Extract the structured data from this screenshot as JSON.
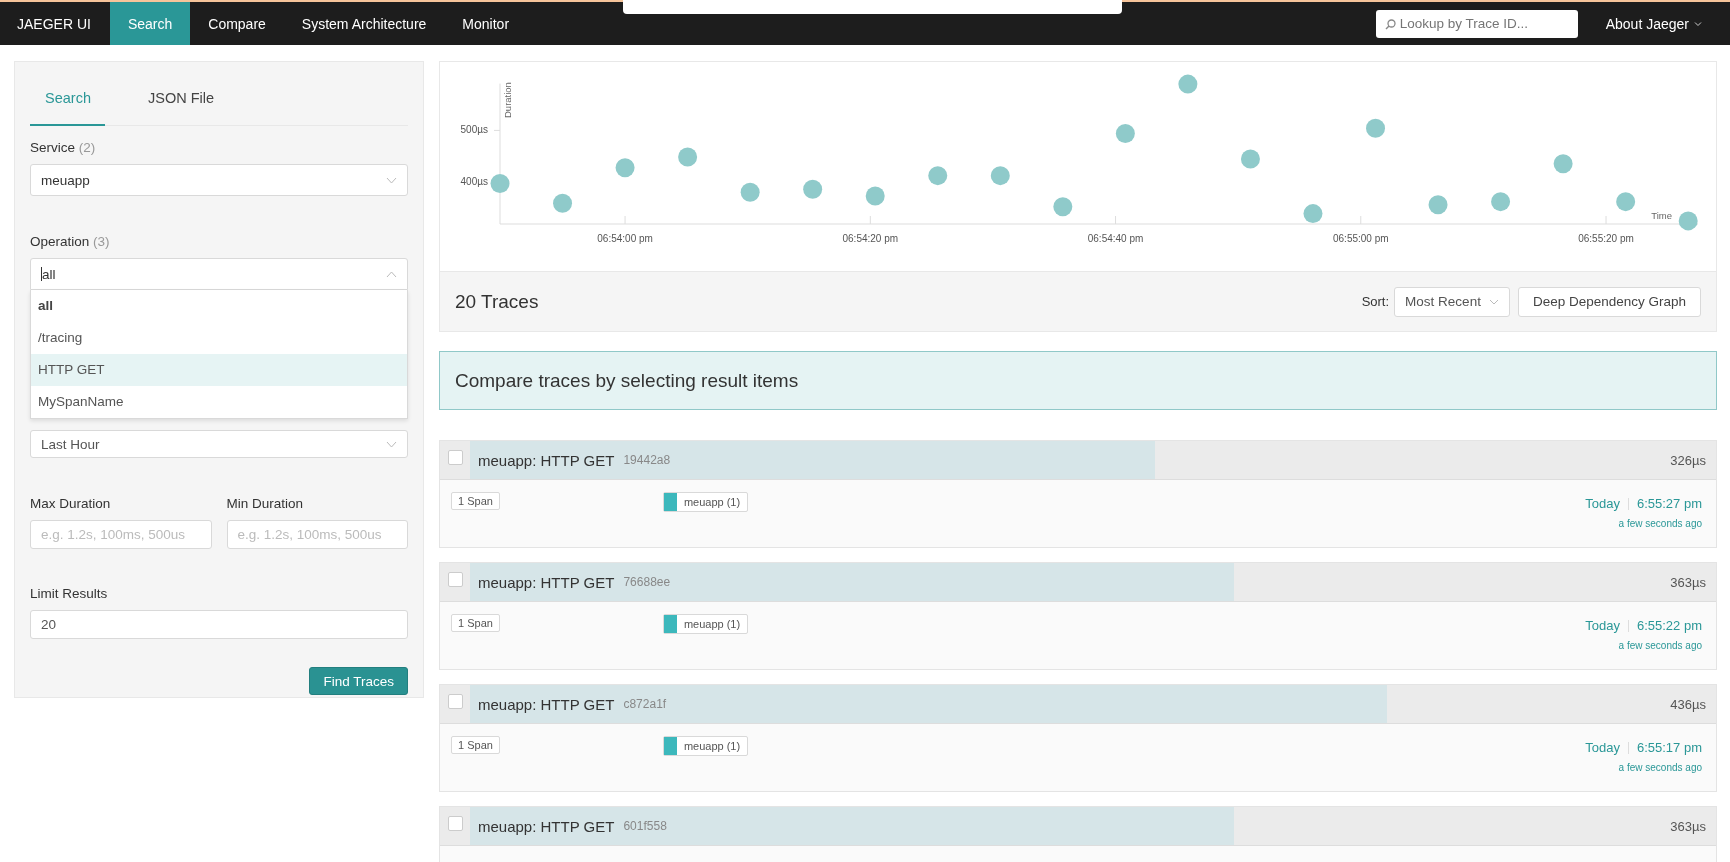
{
  "nav": {
    "brand": "JAEGER UI",
    "tabs": [
      {
        "label": "Search",
        "selected": true
      },
      {
        "label": "Compare",
        "selected": false
      },
      {
        "label": "System Architecture",
        "selected": false
      },
      {
        "label": "Monitor",
        "selected": false
      }
    ],
    "lookup": {
      "placeholder": "Lookup by Trace ID..."
    },
    "about": "About Jaeger"
  },
  "search_panel": {
    "tabs": [
      {
        "label": "Search",
        "selected": true
      },
      {
        "label": "JSON File",
        "selected": false
      }
    ],
    "service": {
      "label": "Service",
      "count": "(2)",
      "value": "meuapp"
    },
    "operation": {
      "label": "Operation",
      "count": "(3)",
      "value": "all",
      "expanded": true,
      "options": [
        {
          "label": "all",
          "selected": true,
          "highlighted": false
        },
        {
          "label": "/tracing",
          "selected": false,
          "highlighted": false
        },
        {
          "label": "HTTP GET",
          "selected": false,
          "highlighted": true
        },
        {
          "label": "MySpanName",
          "selected": false,
          "highlighted": false
        }
      ]
    },
    "lookback": {
      "value": "Last Hour"
    },
    "max_duration": {
      "label": "Max Duration",
      "placeholder": "e.g. 1.2s, 100ms, 500us"
    },
    "min_duration": {
      "label": "Min Duration",
      "placeholder": "e.g. 1.2s, 100ms, 500us"
    },
    "limit": {
      "label": "Limit Results",
      "value": "20"
    },
    "submit": "Find Traces"
  },
  "scatter": {
    "chart_data": {
      "type": "scatter",
      "xlabel": "Time",
      "ylabel": "Duration",
      "series": [
        {
          "color": "#8fcaca",
          "x": [
            68029.8,
            68034.9,
            68040,
            68045.1,
            68050.2,
            68055.3,
            68060.4,
            68065.5,
            68070.6,
            68075.7,
            68080.8,
            68085.9,
            68091,
            68096.1,
            68101.2,
            68106.3,
            68111.4,
            68116.5,
            68121.6,
            68126.7
          ],
          "values": [
            398,
            360,
            428,
            449,
            381,
            387,
            374,
            413,
            413,
            353,
            494,
            589,
            445,
            340,
            504,
            357,
            363,
            436,
            363,
            326
          ]
        }
      ],
      "xlim": [
        68029.8,
        68127.5
      ],
      "ylim": [
        320,
        590
      ],
      "xticks": [
        {
          "value": 68040,
          "label": "06:54:00 pm"
        },
        {
          "value": 68060,
          "label": "06:54:20 pm"
        },
        {
          "value": 68080,
          "label": "06:54:40 pm"
        },
        {
          "value": 68100,
          "label": "06:55:00 pm"
        },
        {
          "value": 68120,
          "label": "06:55:20 pm"
        }
      ],
      "yticks": [
        {
          "value": 400,
          "label": "400µs"
        },
        {
          "value": 500,
          "label": "500µs"
        }
      ]
    }
  },
  "results_header": {
    "count": "20 Traces",
    "sort_label": "Sort:",
    "sort_value": "Most Recent",
    "ddg_button": "Deep Dependency Graph"
  },
  "compare_banner": "Compare traces by selecting result items",
  "traces": [
    {
      "title": "meuapp: HTTP GET",
      "trace_id": "19442a8",
      "duration": "326µs",
      "level": 0.55,
      "checked": false,
      "spans": "1 Span",
      "service": {
        "label": "meuapp (1)",
        "color": "#3cb8bc"
      },
      "day": "Today",
      "time": "6:55:27 pm",
      "ago": "a few seconds ago"
    },
    {
      "title": "meuapp: HTTP GET",
      "trace_id": "76688ee",
      "duration": "363µs",
      "level": 0.613,
      "checked": false,
      "spans": "1 Span",
      "service": {
        "label": "meuapp (1)",
        "color": "#3cb8bc"
      },
      "day": "Today",
      "time": "6:55:22 pm",
      "ago": "a few seconds ago"
    },
    {
      "title": "meuapp: HTTP GET",
      "trace_id": "c872a1f",
      "duration": "436µs",
      "level": 0.736,
      "checked": false,
      "spans": "1 Span",
      "service": {
        "label": "meuapp (1)",
        "color": "#3cb8bc"
      },
      "day": "Today",
      "time": "6:55:17 pm",
      "ago": "a few seconds ago"
    },
    {
      "title": "meuapp: HTTP GET",
      "trace_id": "601f558",
      "duration": "363µs",
      "level": 0.613,
      "checked": false
    }
  ]
}
